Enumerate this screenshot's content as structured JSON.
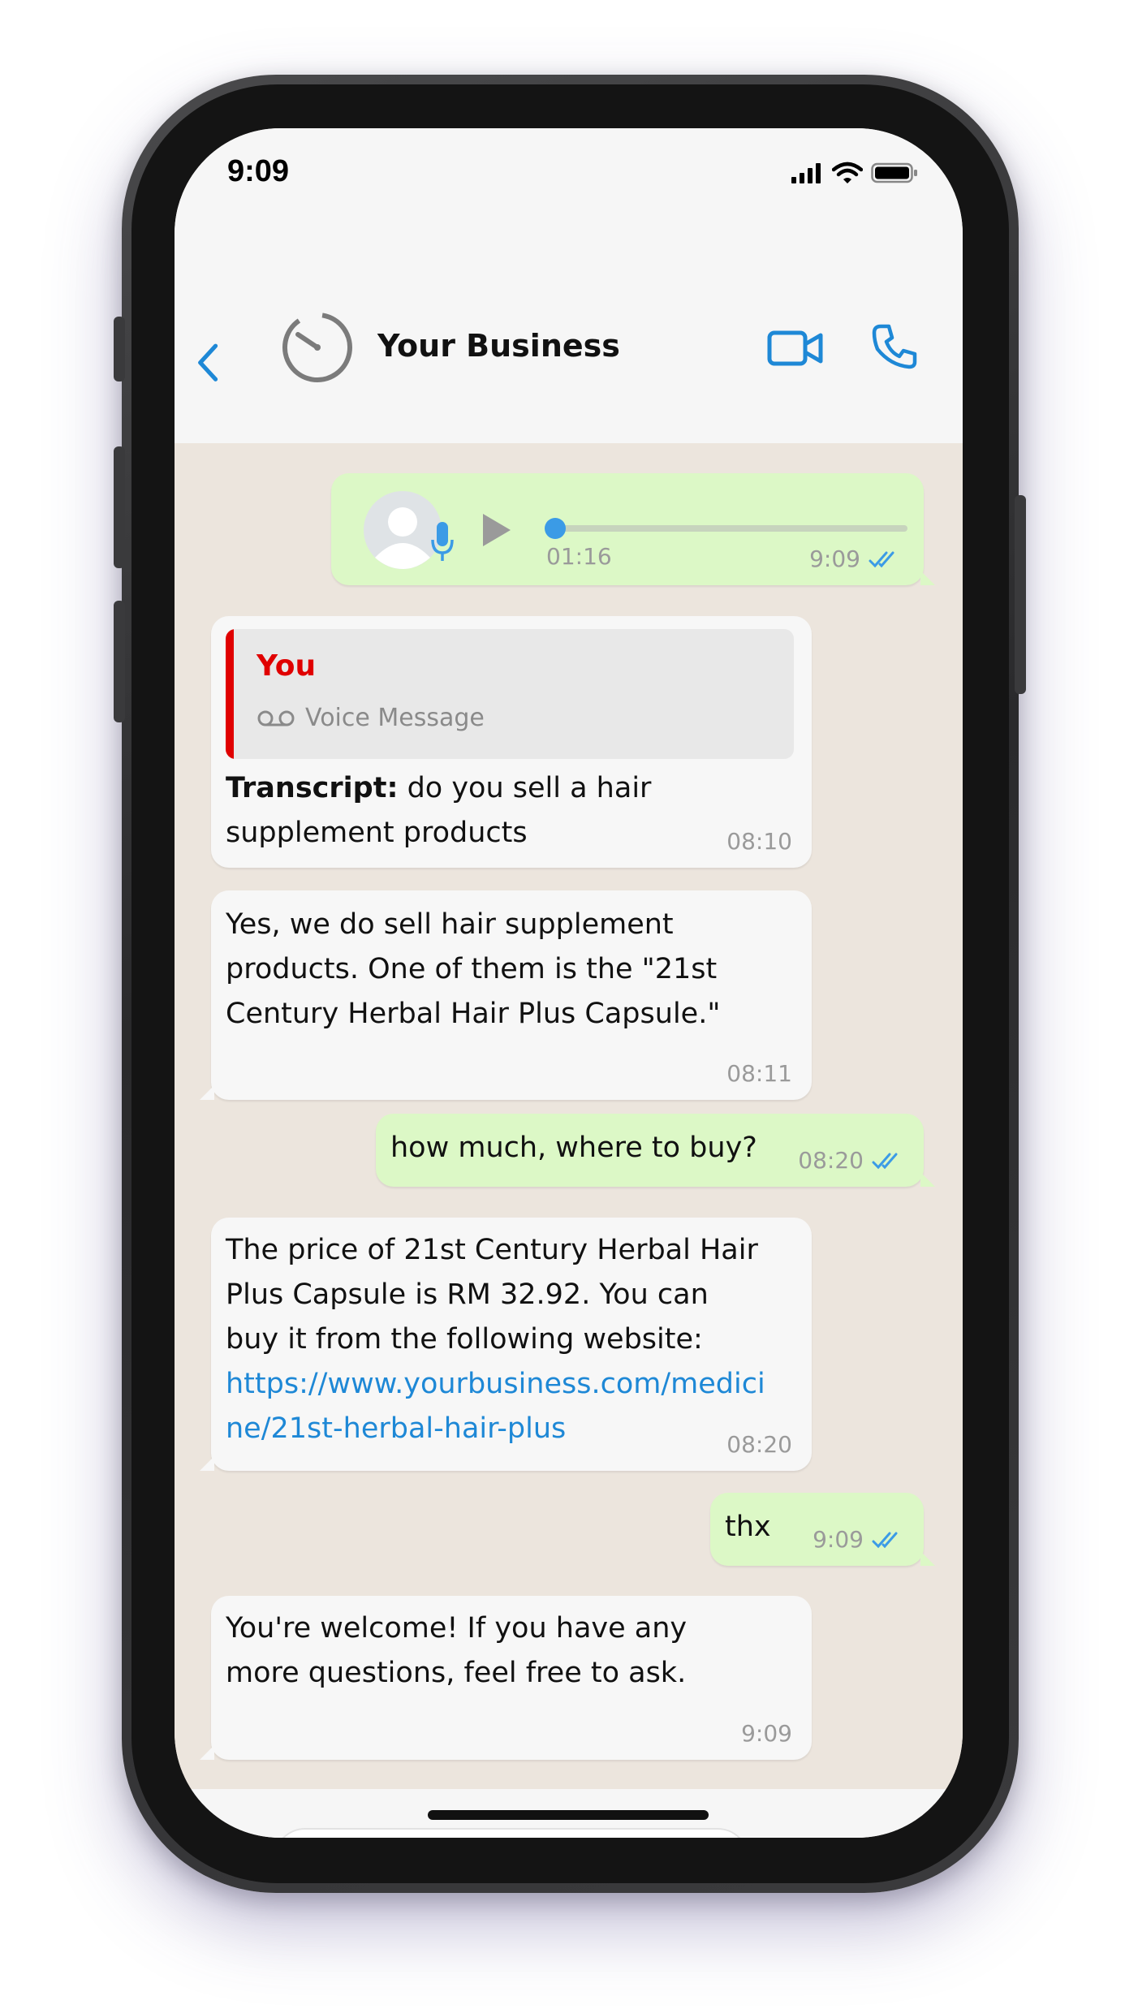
{
  "status_bar": {
    "time": "9:09"
  },
  "header": {
    "back_icon": "chevron-left-icon",
    "contact_name": "Your Business",
    "avatar_icon": "timer-avatar-icon",
    "video_icon": "video-camera-icon",
    "call_icon": "phone-icon"
  },
  "messages": [
    {
      "type": "voice",
      "direction": "outgoing",
      "duration": "01:16",
      "time": "9:09",
      "progress": 0,
      "status": "read"
    },
    {
      "type": "transcript",
      "direction": "incoming",
      "quote_author": "You",
      "quote_text": "Voice Message",
      "label": "Transcript:",
      "text_line1": " do you sell a hair",
      "text_line2": "supplement products",
      "time": "08:10"
    },
    {
      "type": "text",
      "direction": "incoming",
      "lines": [
        "Yes, we do sell hair supplement",
        "products. One of them is the \"21st",
        "Century Herbal Hair Plus Capsule.\""
      ],
      "time": "08:11"
    },
    {
      "type": "text",
      "direction": "outgoing",
      "text": "how much, where to buy?",
      "time": "08:20",
      "status": "read"
    },
    {
      "type": "text",
      "direction": "incoming",
      "lines": [
        "The price of 21st Century Herbal Hair",
        "Plus Capsule is RM 32.92. You can",
        "buy it from the following website:"
      ],
      "link_lines": [
        "https://www.yourbusiness.com/medici",
        "ne/21st-herbal-hair-plus"
      ],
      "time": "08:20"
    },
    {
      "type": "text",
      "direction": "outgoing",
      "text": "thx",
      "time": "9:09",
      "status": "read"
    },
    {
      "type": "text",
      "direction": "incoming",
      "lines": [
        "You're welcome! If you have any",
        "more questions, feel free to ask."
      ],
      "time": "9:09"
    }
  ],
  "input_bar": {
    "placeholder": "",
    "plus_icon": "plus-icon",
    "sticker_icon": "sticker-icon",
    "camera_icon": "camera-icon",
    "mic_icon": "microphone-icon"
  },
  "colors": {
    "incoming_bubble": "#f7f7f7",
    "outgoing_bubble": "#dcf8c6",
    "accent": "#1e88d6",
    "quote_author": "#e00000",
    "chat_background": "#ece5dd"
  }
}
